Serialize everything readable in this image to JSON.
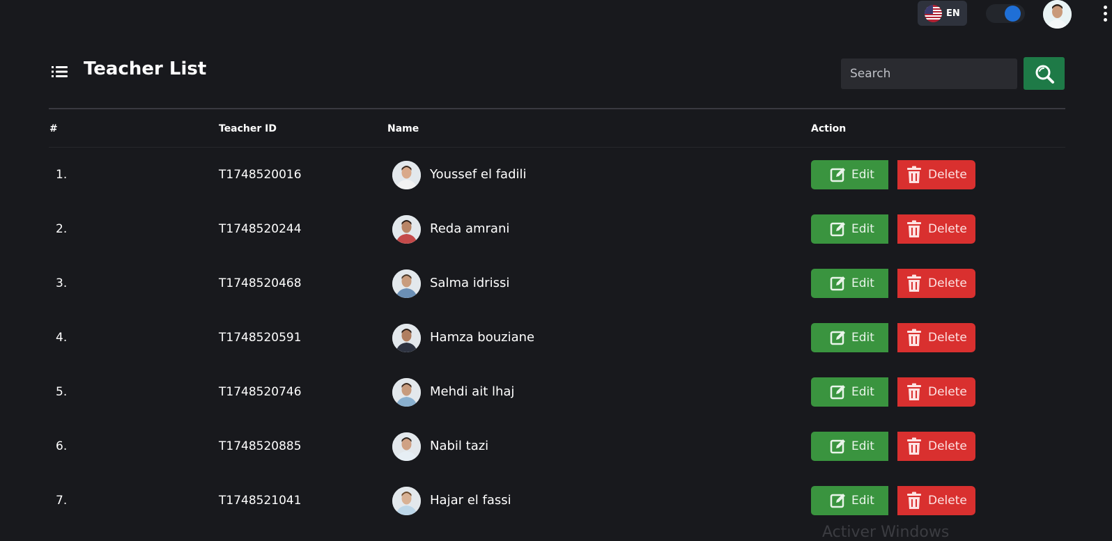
{
  "topbar": {
    "language": "EN",
    "flag_icon": "us-flag-icon",
    "theme_toggle_on": true,
    "menu_icon": "kebab-menu-icon"
  },
  "header": {
    "title": "Teacher List",
    "title_icon": "list-icon"
  },
  "search": {
    "placeholder": "Search",
    "button_icon": "search-icon"
  },
  "table": {
    "columns": [
      "#",
      "Teacher ID",
      "Name",
      "Action"
    ],
    "rows": [
      {
        "num": "1.",
        "id": "T1748520016",
        "name": "Youssef el fadili"
      },
      {
        "num": "2.",
        "id": "T1748520244",
        "name": "Reda amrani"
      },
      {
        "num": "3.",
        "id": "T1748520468",
        "name": "Salma idrissi"
      },
      {
        "num": "4.",
        "id": "T1748520591",
        "name": "Hamza bouziane"
      },
      {
        "num": "5.",
        "id": "T1748520746",
        "name": "Mehdi ait lhaj"
      },
      {
        "num": "6.",
        "id": "T1748520885",
        "name": "Nabil tazi"
      },
      {
        "num": "7.",
        "id": "T1748521041",
        "name": "Hajar el fassi"
      }
    ],
    "edit_label": "Edit",
    "delete_label": "Delete"
  },
  "watermark": "Activer Windows",
  "colors": {
    "background": "#18191d",
    "edit_green": "#3a943f",
    "delete_red": "#d9302f",
    "search_green": "#1e7a47",
    "toggle_blue": "#1f6fd6"
  }
}
